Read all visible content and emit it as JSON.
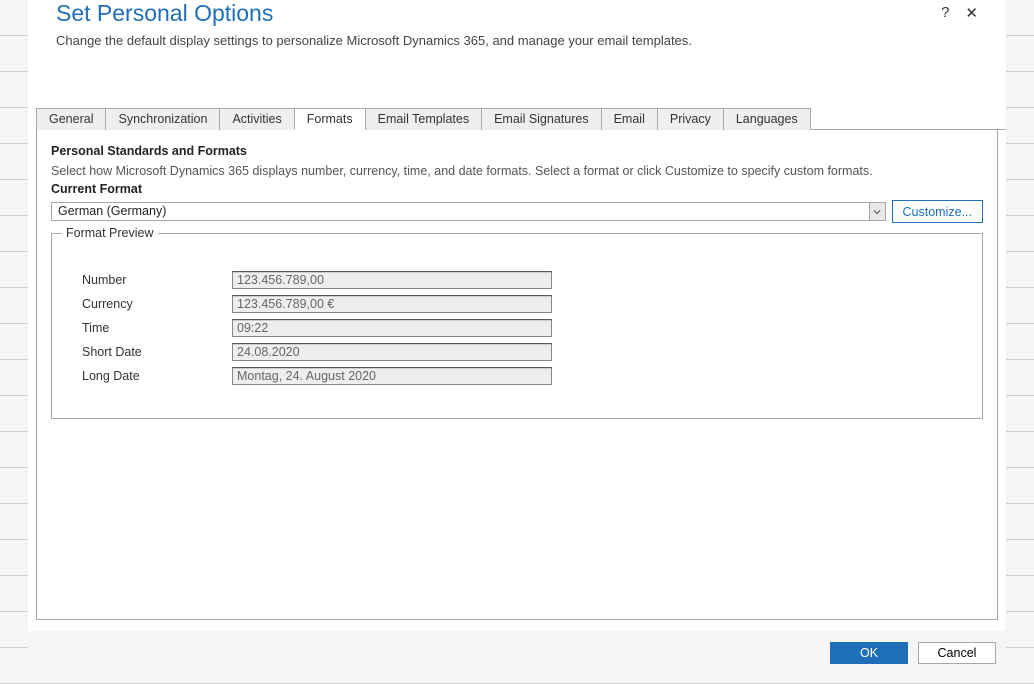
{
  "dialog": {
    "title": "Set Personal Options",
    "subtitle": "Change the default display settings to personalize Microsoft Dynamics 365, and manage your email templates."
  },
  "tabs": [
    {
      "label": "General"
    },
    {
      "label": "Synchronization"
    },
    {
      "label": "Activities"
    },
    {
      "label": "Formats"
    },
    {
      "label": "Email Templates"
    },
    {
      "label": "Email Signatures"
    },
    {
      "label": "Email"
    },
    {
      "label": "Privacy"
    },
    {
      "label": "Languages"
    }
  ],
  "section": {
    "title": "Personal Standards and Formats",
    "desc": "Select how Microsoft Dynamics 365 displays number, currency, time, and date formats. Select a format or click Customize to specify custom formats.",
    "current_label": "Current Format",
    "dropdown_value": "German (Germany)",
    "customize_label": "Customize..."
  },
  "preview": {
    "legend": "Format Preview",
    "rows": [
      {
        "label": "Number",
        "value": "123.456.789,00"
      },
      {
        "label": "Currency",
        "value": "123.456.789,00 €"
      },
      {
        "label": "Time",
        "value": "09:22"
      },
      {
        "label": "Short Date",
        "value": "24.08.2020"
      },
      {
        "label": "Long Date",
        "value": "Montag, 24. August 2020"
      }
    ]
  },
  "footer": {
    "ok": "OK",
    "cancel": "Cancel"
  },
  "header_icons": {
    "help": "?",
    "close": "✕"
  }
}
